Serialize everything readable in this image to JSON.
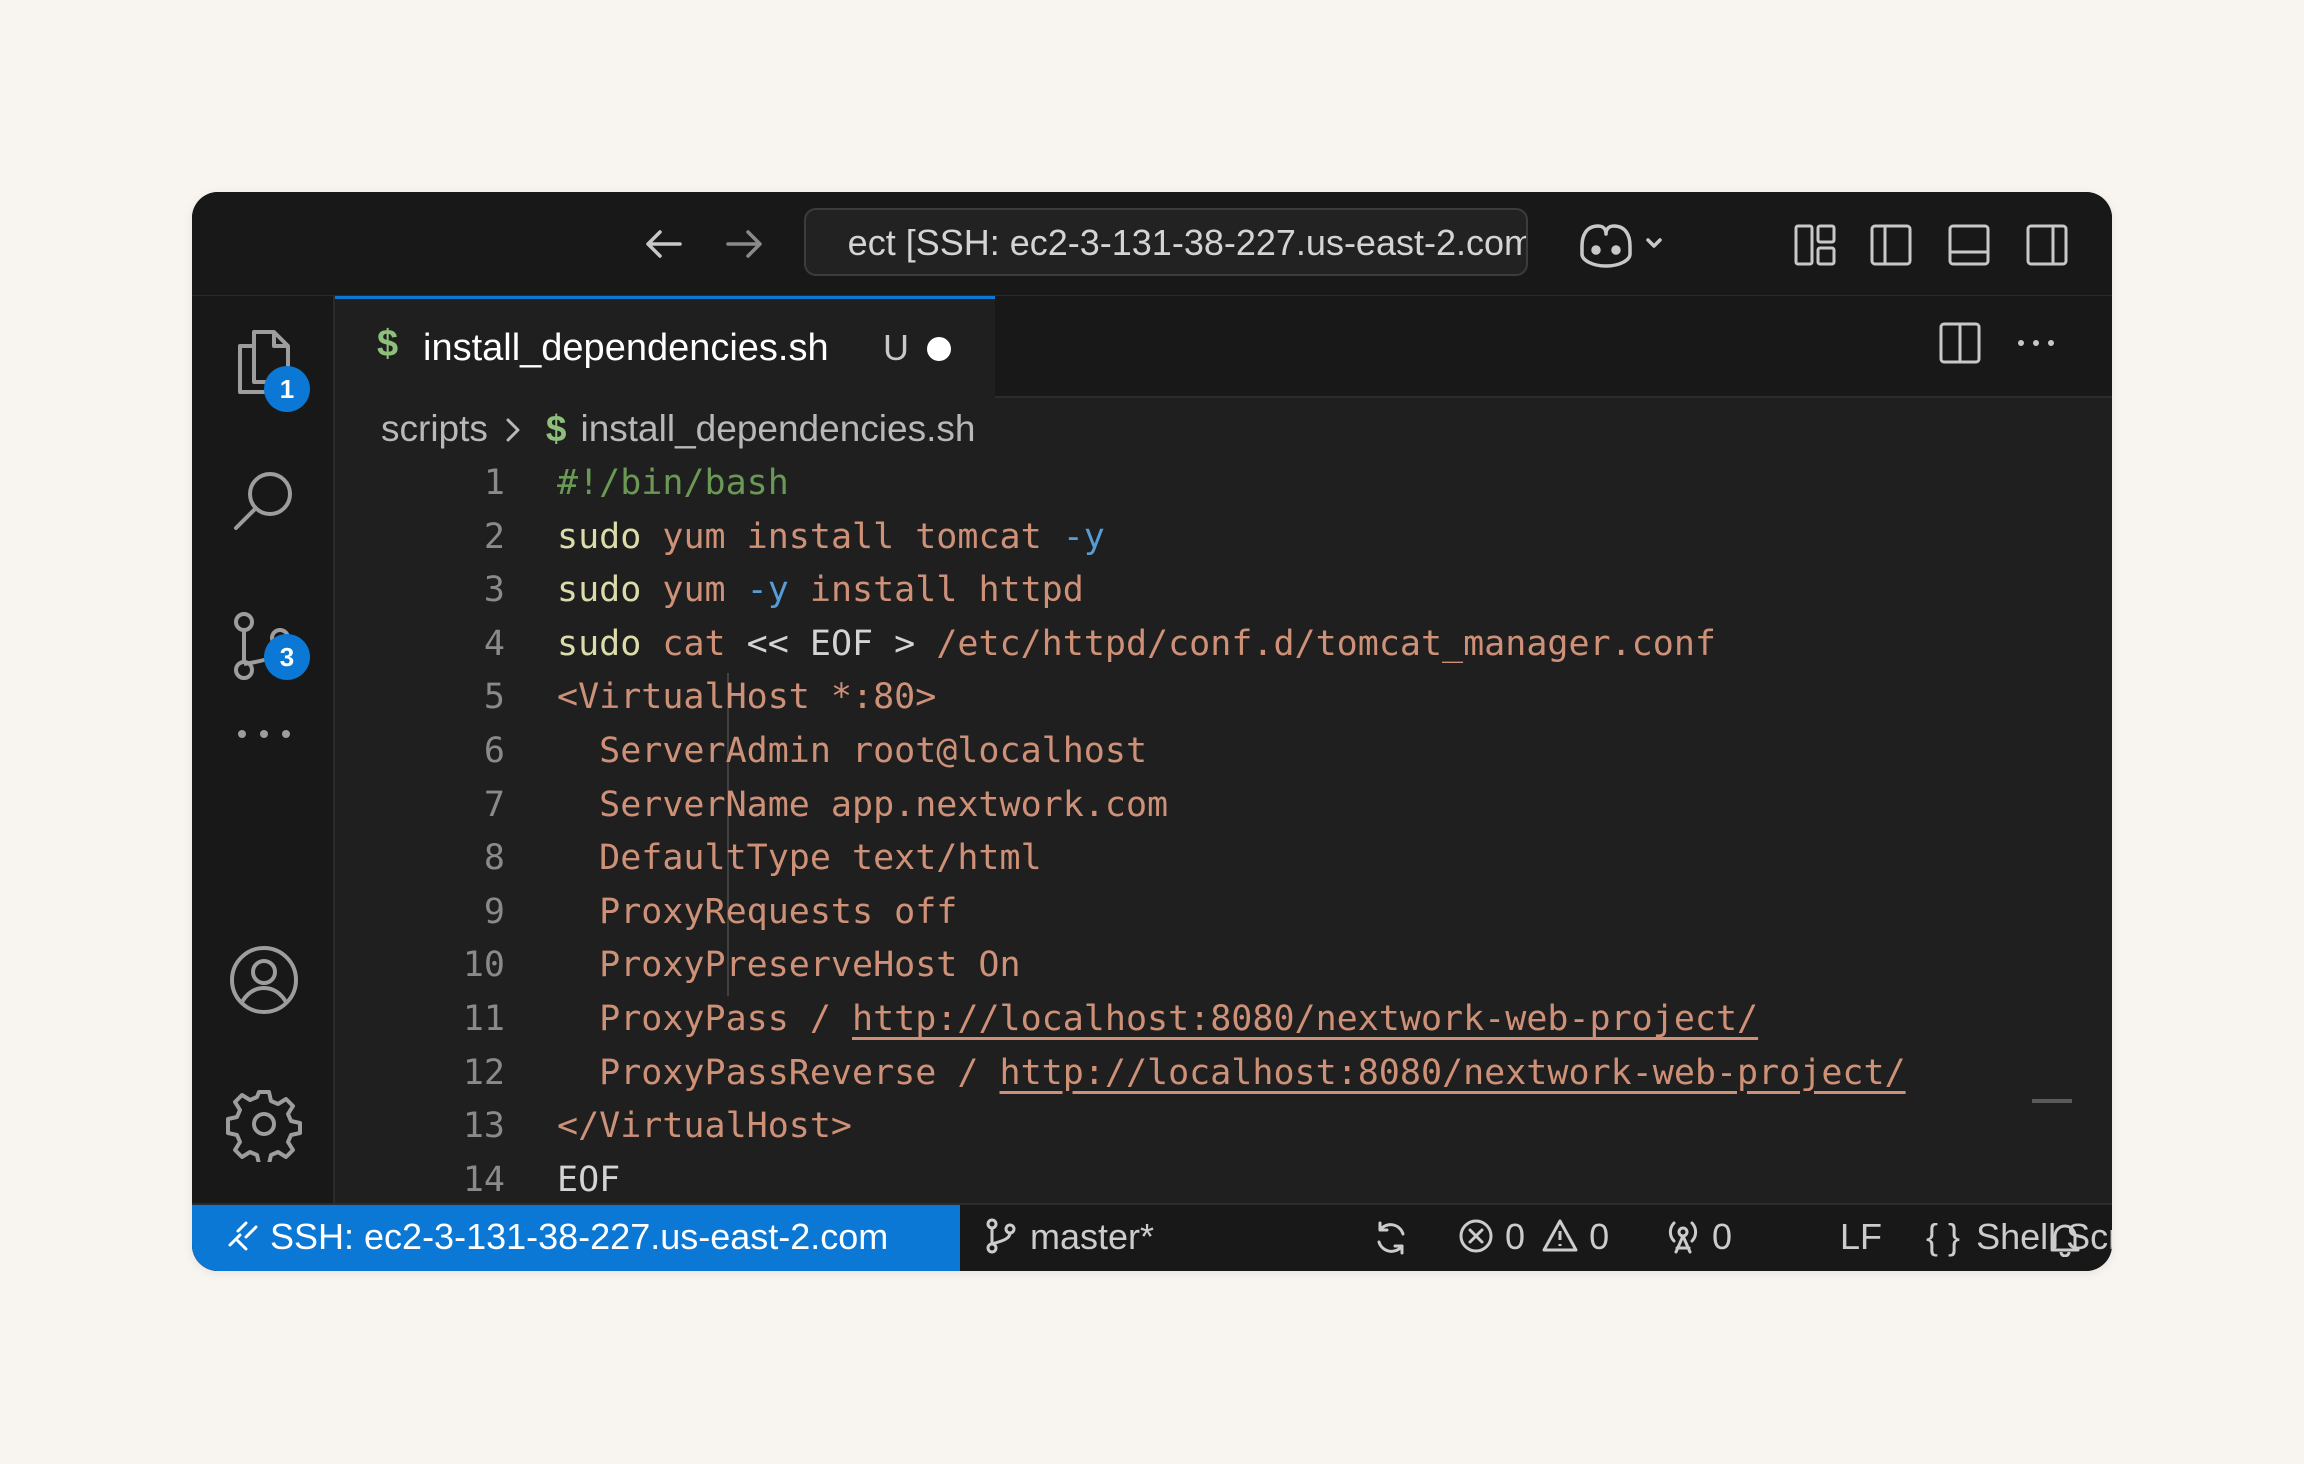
{
  "titlebar": {
    "command_center_text": "ect [SSH: ec2-3-131-38-227.us-east-2.com"
  },
  "activity": {
    "explorer_badge": "1",
    "scm_badge": "3"
  },
  "tab": {
    "icon_glyph": "$",
    "label": "install_dependencies.sh",
    "status": "U"
  },
  "breadcrumb": {
    "folder": "scripts",
    "icon_glyph": "$",
    "file": "install_dependencies.sh"
  },
  "code_lines": [
    {
      "n": "1",
      "segments": [
        {
          "t": "#!/bin/bash",
          "c": "comment"
        }
      ]
    },
    {
      "n": "2",
      "segments": [
        {
          "t": "sudo",
          "c": "cmd"
        },
        {
          "t": " yum install tomcat ",
          "c": "str"
        },
        {
          "t": "-y",
          "c": "flag"
        }
      ]
    },
    {
      "n": "3",
      "segments": [
        {
          "t": "sudo",
          "c": "cmd"
        },
        {
          "t": " yum ",
          "c": "str"
        },
        {
          "t": "-y",
          "c": "flag"
        },
        {
          "t": " install httpd",
          "c": "str"
        }
      ]
    },
    {
      "n": "4",
      "segments": [
        {
          "t": "sudo",
          "c": "cmd"
        },
        {
          "t": " cat ",
          "c": "str"
        },
        {
          "t": "<< EOF > ",
          "c": "plain"
        },
        {
          "t": "/etc/httpd/conf.d/tomcat_manager.conf",
          "c": "str"
        }
      ]
    },
    {
      "n": "5",
      "segments": [
        {
          "t": "<VirtualHost *:80>",
          "c": "str"
        }
      ]
    },
    {
      "n": "6",
      "segments": [
        {
          "t": "  ServerAdmin root@localhost",
          "c": "str"
        }
      ]
    },
    {
      "n": "7",
      "segments": [
        {
          "t": "  ServerName app.nextwork.com",
          "c": "str"
        }
      ]
    },
    {
      "n": "8",
      "segments": [
        {
          "t": "  DefaultType text/html",
          "c": "str"
        }
      ]
    },
    {
      "n": "9",
      "segments": [
        {
          "t": "  ProxyRequests off",
          "c": "str"
        }
      ]
    },
    {
      "n": "10",
      "segments": [
        {
          "t": "  ProxyPreserveHost On",
          "c": "str"
        }
      ]
    },
    {
      "n": "11",
      "segments": [
        {
          "t": "  ProxyPass / ",
          "c": "str"
        },
        {
          "t": "http://localhost:8080/nextwork-web-project/",
          "c": "link"
        }
      ]
    },
    {
      "n": "12",
      "segments": [
        {
          "t": "  ProxyPassReverse / ",
          "c": "str"
        },
        {
          "t": "http://localhost:8080/nextwork-web-project/",
          "c": "link"
        }
      ]
    },
    {
      "n": "13",
      "segments": [
        {
          "t": "</VirtualHost>",
          "c": "str"
        }
      ]
    },
    {
      "n": "14",
      "segments": [
        {
          "t": "EOF",
          "c": "plain"
        }
      ]
    }
  ],
  "statusbar": {
    "remote_label": "SSH: ec2-3-131-38-227.us-east-2.com",
    "branch": "master*",
    "errors": "0",
    "warnings": "0",
    "ports": "0",
    "eol": "LF",
    "language_glyph": "{ }",
    "language": "Shell Script"
  },
  "colors": {
    "accent": "#0a78d4",
    "background": "#1f1f1f",
    "string": "#ce9178",
    "command": "#dcdcaa",
    "comment": "#6a9955",
    "flag": "#569cd6"
  }
}
